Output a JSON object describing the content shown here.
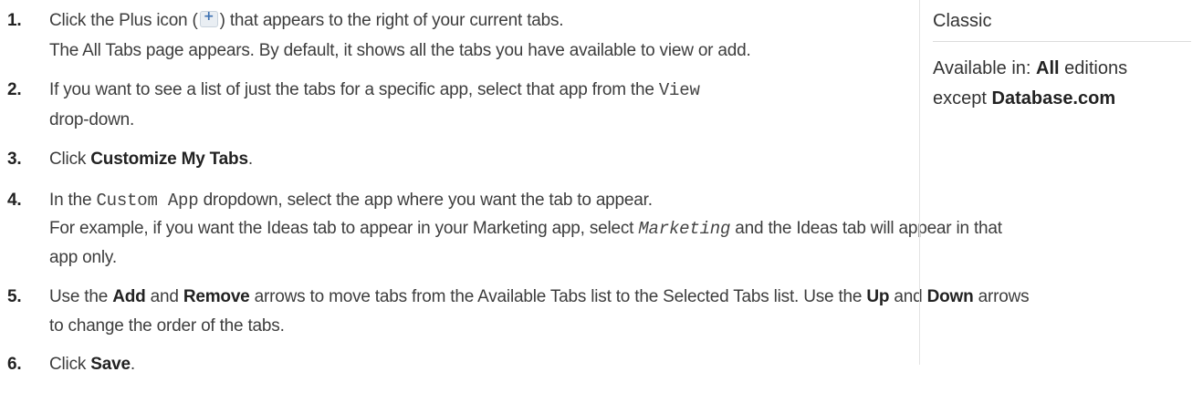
{
  "steps": [
    {
      "num": "1.",
      "lines": [
        {
          "a": "Click the Plus icon (",
          "b": ") that appears to the right of your current tabs."
        },
        {
          "text": "The All Tabs page appears. By default, it shows all the tabs you have available to view or add."
        }
      ]
    },
    {
      "num": "2.",
      "line1_pre": "If you want to see a list of just the tabs for a specific app, select that app from the",
      "line1_code": "View",
      "line2": "drop-down."
    },
    {
      "num": "3.",
      "pre": "Click",
      "bold": "Customize My Tabs",
      "post": "."
    },
    {
      "num": "4.",
      "line1_pre": "In the",
      "line1_code": "Custom App",
      "line1_post": "dropdown, select the app where you want the tab to appear.",
      "line2_pre": "For example, if you want the Ideas tab to appear in your Marketing app, select",
      "line2_code": "Marketing",
      "line2_post": "and the Ideas tab will appear in that",
      "line3": "app only."
    },
    {
      "num": "5.",
      "l1": [
        "Use the",
        "Add",
        "and",
        "Remove",
        "arrows to move tabs from the Available Tabs list to the Selected Tabs list. Use the",
        "Up",
        "and",
        "Down",
        "arrows"
      ],
      "l2": "to change the order of the tabs."
    },
    {
      "num": "6.",
      "pre": "Click",
      "bold": "Save",
      "post": "."
    }
  ],
  "sidebar": {
    "heading": "Classic",
    "avail_pre": "Available in:",
    "avail_bold": "All",
    "avail_post": "editions",
    "except_pre": "except",
    "except_bold": "Database.com"
  },
  "icons": {
    "plus": "+"
  }
}
